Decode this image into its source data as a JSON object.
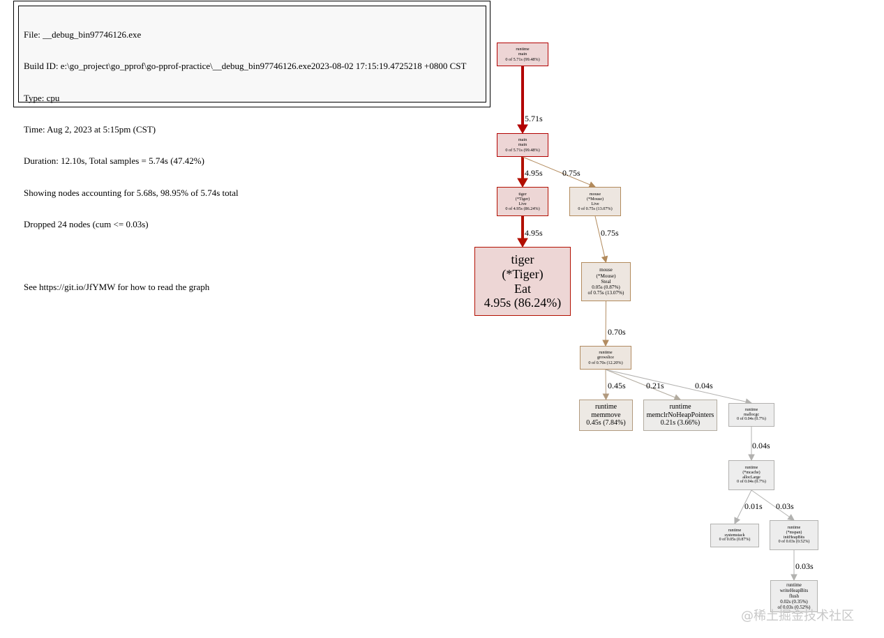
{
  "legend": {
    "lines": [
      "File: __debug_bin97746126.exe",
      "Build ID: e:\\go_project\\go_pprof\\go-pprof-practice\\__debug_bin97746126.exe2023-08-02 17:15:19.4725218 +0800 CST",
      "Type: cpu",
      "Time: Aug 2, 2023 at 5:15pm (CST)",
      "Duration: 12.10s, Total samples = 5.74s (47.42%)",
      "Showing nodes accounting for 5.68s, 98.95% of 5.74s total",
      "Dropped 24 nodes (cum <= 0.03s)",
      "",
      "See https://git.io/JfYMW for how to read the graph"
    ]
  },
  "nodes": [
    {
      "id": "runtime_main",
      "lines": [
        "runtime",
        "main",
        "0 of 5.71s (99.48%)"
      ],
      "fill": "#edd5d5",
      "stroke": "#b20000"
    },
    {
      "id": "main_main",
      "lines": [
        "main",
        "main",
        "0 of 5.71s (99.48%)"
      ],
      "fill": "#edd5d5",
      "stroke": "#b20000"
    },
    {
      "id": "tiger_live",
      "lines": [
        "tiger",
        "(*Tiger)",
        "Live",
        "0 of 4.95s (86.24%)"
      ],
      "fill": "#edd6d5",
      "stroke": "#b20f00"
    },
    {
      "id": "mouse_live",
      "lines": [
        "mouse",
        "(*Mouse)",
        "Live",
        "0 of 0.75s (13.07%)"
      ],
      "fill": "#ede6e0",
      "stroke": "#b28a5c"
    },
    {
      "id": "tiger_eat",
      "lines": [
        "tiger",
        "(*Tiger)",
        "Eat",
        "4.95s (86.24%)"
      ],
      "fill": "#edd6d5",
      "stroke": "#b20f00"
    },
    {
      "id": "mouse_steal",
      "lines": [
        "mouse",
        "(*Mouse)",
        "Steal",
        "0.05s (0.87%)",
        "of 0.75s (13.07%)"
      ],
      "fill": "#ede6e0",
      "stroke": "#b28a5c"
    },
    {
      "id": "runtime_growslice",
      "lines": [
        "runtime",
        "growslice",
        "0 of 0.70s (12.20%)"
      ],
      "fill": "#ede6df",
      "stroke": "#b28c62"
    },
    {
      "id": "runtime_memmove",
      "lines": [
        "runtime",
        "memmove",
        "0.45s (7.84%)"
      ],
      "fill": "#ede9e4",
      "stroke": "#b29a7e"
    },
    {
      "id": "runtime_memclr",
      "lines": [
        "runtime",
        "memclrNoHeapPointers",
        "0.21s (3.66%)"
      ],
      "fill": "#edecea",
      "stroke": "#b2ab9f"
    },
    {
      "id": "runtime_mallocgc",
      "lines": [
        "runtime",
        "mallocgc",
        "0 of 0.04s (0.7%)"
      ],
      "fill": "#ededed",
      "stroke": "#b2b1af"
    },
    {
      "id": "runtime_alloclarge",
      "lines": [
        "runtime",
        "(*mcache)",
        "allocLarge",
        "0 of 0.04s (0.7%)"
      ],
      "fill": "#ededed",
      "stroke": "#b2b1af"
    },
    {
      "id": "runtime_systemstack",
      "lines": [
        "runtime",
        "systemstack",
        "0 of 0.05s (0.87%)"
      ],
      "fill": "#ededed",
      "stroke": "#b2b1af"
    },
    {
      "id": "runtime_initheapbits",
      "lines": [
        "runtime",
        "(*mspan)",
        "initHeapBits",
        "0 of 0.03s (0.52%)"
      ],
      "fill": "#ededed",
      "stroke": "#b2b2b0"
    },
    {
      "id": "runtime_flush",
      "lines": [
        "runtime",
        "writeHeapBits",
        "flush",
        "0.02s (0.35%)",
        "of 0.03s (0.52%)"
      ],
      "fill": "#ededed",
      "stroke": "#b2b2b0"
    }
  ],
  "edges": [
    {
      "from": "runtime_main",
      "to": "main_main",
      "label": "5.71s",
      "color": "#b20000"
    },
    {
      "from": "main_main",
      "to": "tiger_live",
      "label": "4.95s",
      "color": "#b20f00"
    },
    {
      "from": "main_main",
      "to": "mouse_live",
      "label": "0.75s",
      "color": "#b28a5c"
    },
    {
      "from": "tiger_live",
      "to": "tiger_eat",
      "label": "4.95s",
      "color": "#b20f00"
    },
    {
      "from": "mouse_live",
      "to": "mouse_steal",
      "label": "0.75s",
      "color": "#b28a5c"
    },
    {
      "from": "mouse_steal",
      "to": "runtime_growslice",
      "label": "0.70s",
      "color": "#b28c62"
    },
    {
      "from": "runtime_growslice",
      "to": "runtime_memmove",
      "label": "0.45s",
      "color": "#b29a7e"
    },
    {
      "from": "runtime_growslice",
      "to": "runtime_memclr",
      "label": "0.21s",
      "color": "#b2ab9f"
    },
    {
      "from": "runtime_growslice",
      "to": "runtime_mallocgc",
      "label": "0.04s",
      "color": "#b2b1af"
    },
    {
      "from": "runtime_mallocgc",
      "to": "runtime_alloclarge",
      "label": "0.04s",
      "color": "#b2b1af"
    },
    {
      "from": "runtime_alloclarge",
      "to": "runtime_systemstack",
      "label": "0.01s",
      "color": "#b2b2b1"
    },
    {
      "from": "runtime_alloclarge",
      "to": "runtime_initheapbits",
      "label": "0.03s",
      "color": "#b2b2b0"
    },
    {
      "from": "runtime_initheapbits",
      "to": "runtime_flush",
      "label": "0.03s",
      "color": "#b2b2b0"
    }
  ],
  "watermark": "@稀土掘金技术社区"
}
